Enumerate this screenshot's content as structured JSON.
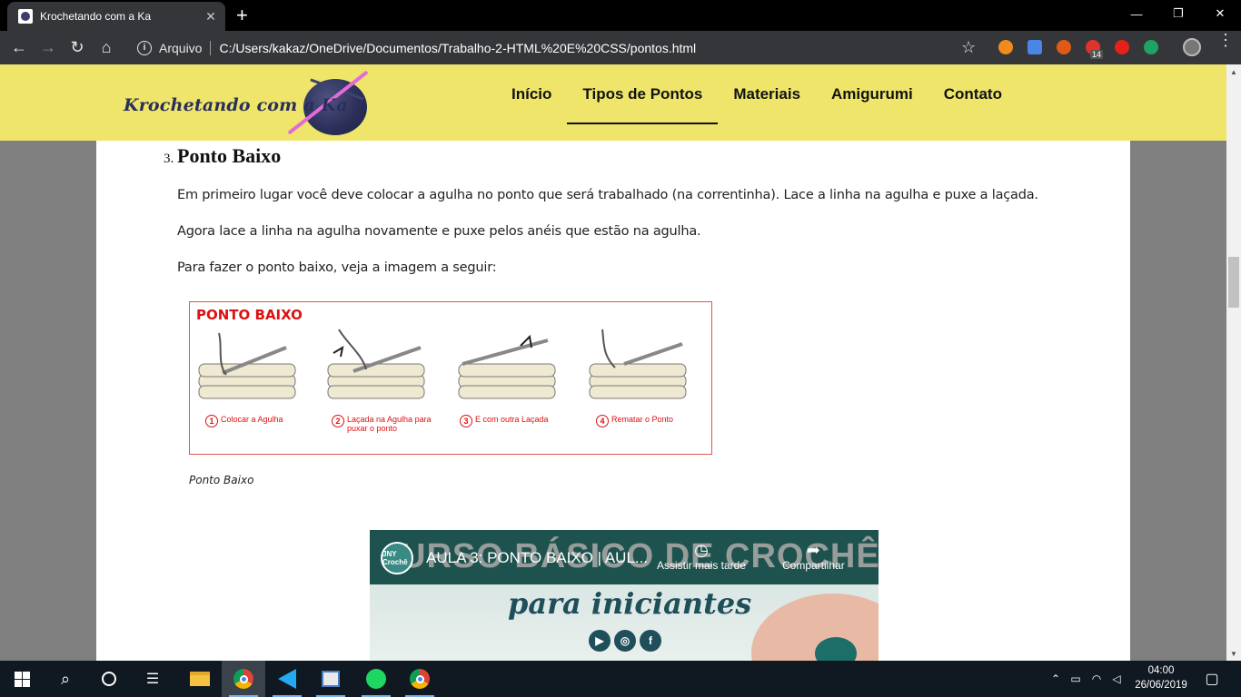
{
  "browser": {
    "tab_title": "Krochetando com a Ka",
    "tab_close": "✕",
    "new_tab": "+",
    "window_controls": [
      "—",
      "❐",
      "✕"
    ],
    "omnibox": {
      "scheme_label": "Arquivo",
      "url": "C:/Users/kakaz/OneDrive/Documentos/Trabalho-2-HTML%20E%20CSS/pontos.html"
    },
    "extensions": [
      {
        "icon": "play-circle-icon",
        "color": "#f28a1e"
      },
      {
        "icon": "google-translate-icon",
        "color": "#4a86e8"
      },
      {
        "icon": "fox-icon",
        "color": "#e05a16"
      },
      {
        "icon": "notification-icon",
        "color": "#e0332b"
      },
      {
        "icon": "youtube-icon",
        "color": "#e62117"
      },
      {
        "icon": "green-extension-icon",
        "color": "#1ea362"
      }
    ],
    "badge_count": "14"
  },
  "site": {
    "logo_text": "Krochetando com a Ka",
    "nav": [
      {
        "label": "Início",
        "active": false
      },
      {
        "label": "Tipos de Pontos",
        "active": true
      },
      {
        "label": "Materiais",
        "active": false
      },
      {
        "label": "Amigurumi",
        "active": false
      },
      {
        "label": "Contato",
        "active": false
      }
    ]
  },
  "content": {
    "step_number": "3.",
    "step_title": "Ponto Baixo",
    "paragraphs": [
      "Em primeiro lugar você deve colocar a agulha no ponto que será trabalhado (na correntinha). Lace a linha na agulha e puxe a laçada.",
      "Agora lace a linha na agulha novamente e puxe pelos anéis que estão na agulha.",
      "Para fazer o ponto baixo, veja a imagem a seguir:"
    ],
    "figure": {
      "title": "PONTO BAIXO",
      "steps": [
        {
          "num": "1",
          "text": "Colocar a Agulha"
        },
        {
          "num": "2",
          "text": "Laçada na Agulha para puxar o ponto"
        },
        {
          "num": "3",
          "text": "E com outra Laçada"
        },
        {
          "num": "4",
          "text": "Rematar o Ponto"
        }
      ],
      "caption": "Ponto Baixo"
    },
    "video": {
      "channel": "JNY Crochê",
      "title": "AULA 3: PONTO BAIXO | AUL...",
      "banner_text": "URSO BÁSICO DE CROCHÊ",
      "subtitle": "para iniciantes",
      "watch_later": "Assistir mais tarde",
      "share": "Compartilhar"
    }
  },
  "taskbar": {
    "time": "04:00",
    "date": "26/06/2019",
    "apps": [
      "windows-start-icon",
      "search-icon",
      "cortana-icon",
      "task-view-icon",
      "file-explorer-icon",
      "chrome-icon",
      "vscode-icon",
      "photos-icon",
      "spotify-icon",
      "chrome-icon"
    ]
  }
}
